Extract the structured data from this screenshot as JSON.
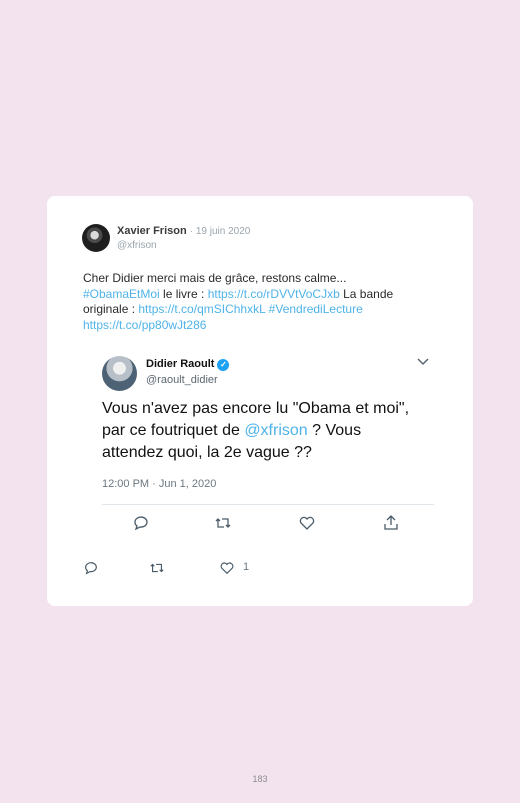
{
  "tweet": {
    "author_name": "Xavier Frison",
    "date": "· 19 juin 2020",
    "handle": "@xfrison",
    "text_intro": "Cher Didier merci mais de grâce, restons calme...",
    "hashtag1": "#ObamaEtMoi",
    "text_livre": " le livre : ",
    "link1": "https://t.co/rDVVtVoCJxb",
    "text_bande": " La bande originale : ",
    "link2": "https://t.co/qmSIChhxkL",
    "hashtag2": "#VendrediLecture",
    "link3": "https://t.co/pp80wJt286",
    "like_count": "1"
  },
  "embedded_tweet": {
    "author_name": "Didier Raoult",
    "verified_glyph": "✓",
    "handle": "@raoult_didier",
    "text_before": "Vous n'avez pas encore lu \"Obama et moi\", par ce foutriquet de ",
    "mention": "@xfrison",
    "text_after": " ? Vous attendez quoi, la 2e vague ??",
    "timestamp": "12:00 PM · Jun 1, 2020"
  },
  "page": {
    "number": "183"
  },
  "colors": {
    "background": "#f3e3ee",
    "link": "#4fb3e8",
    "verified": "#1da1f2"
  },
  "icons": [
    "reply-icon",
    "retweet-icon",
    "like-icon",
    "share-icon",
    "chevron-down-icon",
    "verified-badge-icon"
  ]
}
